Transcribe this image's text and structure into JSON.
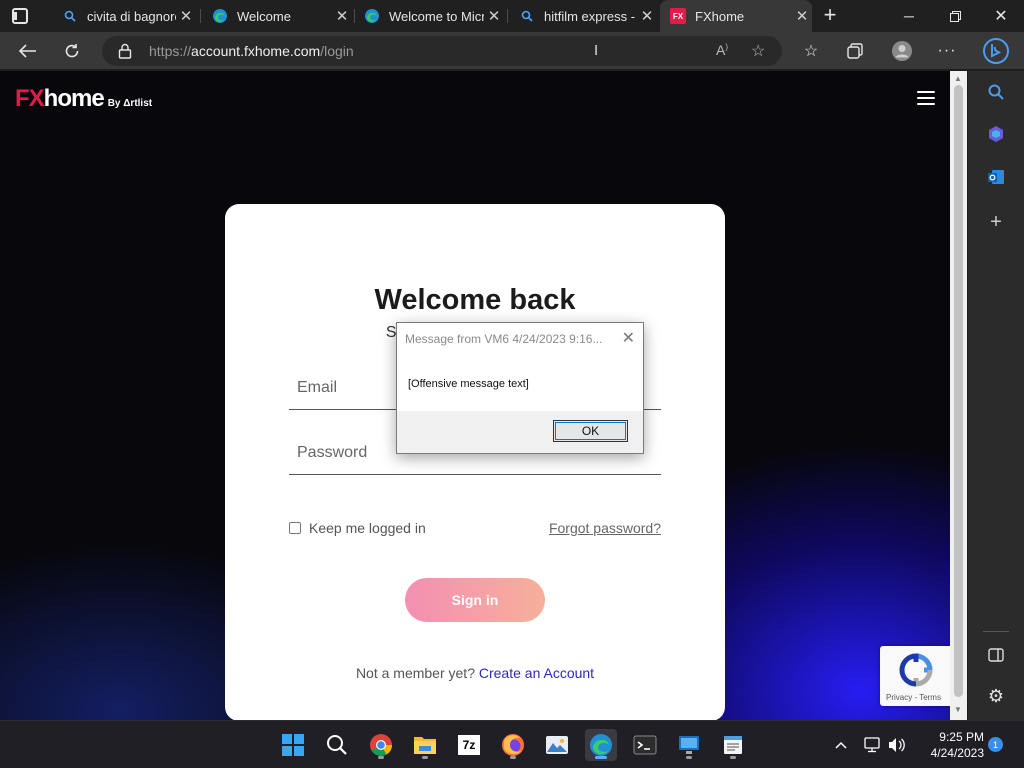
{
  "browser": {
    "tabs": [
      {
        "title": "civita di bagnoregio",
        "icon": "search-icon"
      },
      {
        "title": "Welcome",
        "icon": "edge-icon"
      },
      {
        "title": "Welcome to Microsoft Edge",
        "icon": "edge-icon"
      },
      {
        "title": "hitfilm express -",
        "icon": "search-icon"
      },
      {
        "title": "FXhome",
        "icon": "fxhome-icon",
        "favicon_text": "FX",
        "active": true
      }
    ],
    "url_scheme": "https://",
    "url_domain": "account.fxhome.com",
    "url_path": "/login"
  },
  "page": {
    "logo_fx": "FX",
    "logo_home": "home",
    "logo_by": "By Δrtlist",
    "welcome": "Welcome back",
    "subtitle": "Si",
    "email_placeholder": "Email",
    "password_placeholder": "Password",
    "keep_logged_in": "Keep me logged in",
    "forgot_password": "Forgot password?",
    "sign_in": "Sign in",
    "not_member": "Not a member yet? ",
    "create_account": "Create an Account",
    "recaptcha_links": "Privacy - Terms"
  },
  "dialog": {
    "title": "Message from VM6 4/24/2023 9:16...",
    "message": "[Offensive message text]",
    "ok": "OK"
  },
  "taskbar": {
    "time": "9:25 PM",
    "date": "4/24/2023",
    "notification_count": "1",
    "apps": [
      "start",
      "search",
      "chrome",
      "file-explorer",
      "7zip",
      "firefox",
      "photos",
      "edge",
      "terminal",
      "remote-desktop",
      "notepad"
    ]
  },
  "colors": {
    "brand_red": "#e6194b",
    "sign_in_gradient_start": "#f48fb3",
    "sign_in_gradient_end": "#f6b09a",
    "link_blue": "#2a2bb8",
    "browser_dark": "#202020"
  }
}
